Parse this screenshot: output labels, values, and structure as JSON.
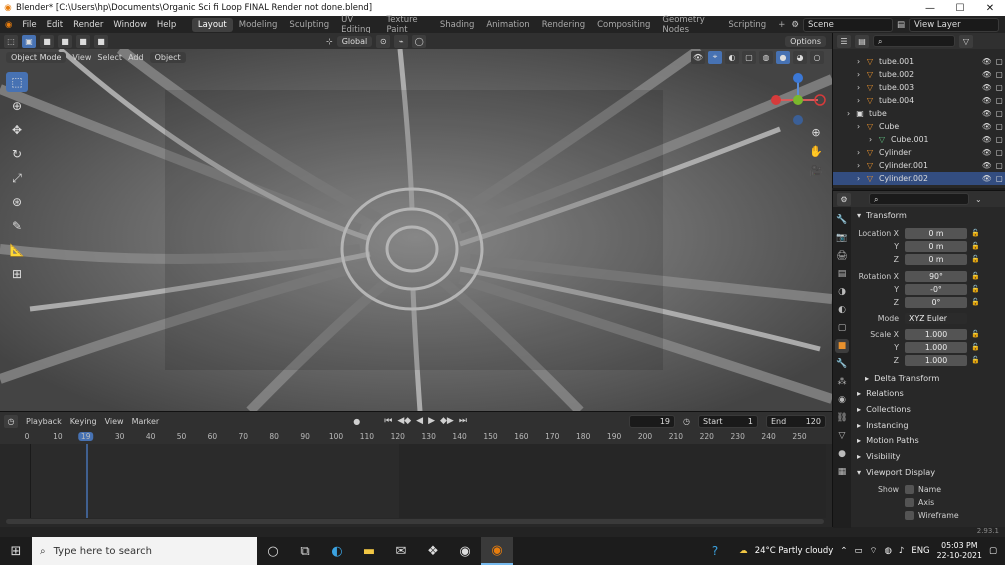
{
  "window": {
    "title": "Blender* [C:\\Users\\hp\\Documents\\Organic Sci fi Loop FINAL Render not done.blend]",
    "minimize": "—",
    "maximize": "☐",
    "close": "✕"
  },
  "menus": [
    "File",
    "Edit",
    "Render",
    "Window",
    "Help"
  ],
  "workspaces": [
    "Layout",
    "Modeling",
    "Sculpting",
    "UV Editing",
    "Texture Paint",
    "Shading",
    "Animation",
    "Rendering",
    "Compositing",
    "Geometry Nodes",
    "Scripting"
  ],
  "active_workspace": "Layout",
  "scene": "Scene",
  "view_layer": "View Layer",
  "viewport": {
    "transform_orientation": "Global",
    "options": "Options",
    "mode": "Object Mode",
    "menus": [
      "View",
      "Select",
      "Add",
      "Object"
    ]
  },
  "outliner": {
    "rows": [
      {
        "label": "tube.001",
        "icon": "object-icon",
        "sel": false
      },
      {
        "label": "tube.002",
        "icon": "object-icon",
        "sel": false
      },
      {
        "label": "tube.003",
        "icon": "object-icon",
        "sel": false
      },
      {
        "label": "tube.004",
        "icon": "object-icon",
        "sel": false
      },
      {
        "label": "tube",
        "icon": "collection-icon",
        "sel": false
      },
      {
        "label": "Cube",
        "icon": "object-icon",
        "sel": false
      },
      {
        "label": "Cube.001",
        "icon": "mesh-icon",
        "sel": false
      },
      {
        "label": "Cylinder",
        "icon": "object-icon",
        "sel": false
      },
      {
        "label": "Cylinder.001",
        "icon": "object-icon",
        "sel": false
      },
      {
        "label": "Cylinder.002",
        "icon": "object-icon",
        "sel": true
      }
    ]
  },
  "properties": {
    "transform_title": "Transform",
    "location_label": "Location X",
    "y_label": "Y",
    "z_label": "Z",
    "location": [
      "0 m",
      "0 m",
      "0 m"
    ],
    "rotation_label": "Rotation X",
    "rotation": [
      "90°",
      "-0°",
      "0°"
    ],
    "mode_label": "Mode",
    "mode_value": "XYZ Euler",
    "scale_label": "Scale X",
    "scale": [
      "1.000",
      "1.000",
      "1.000"
    ],
    "sections": [
      "Delta Transform",
      "Relations",
      "Collections",
      "Instancing",
      "Motion Paths",
      "Visibility",
      "Viewport Display"
    ],
    "show_label": "Show",
    "show_items": [
      "Name",
      "Axis",
      "Wireframe"
    ]
  },
  "timeline": {
    "menus": [
      "Playback",
      "Keying",
      "View",
      "Marker"
    ],
    "current_frame": "19",
    "start_label": "Start",
    "start": "1",
    "end_label": "End",
    "end": "120",
    "ticks": [
      "0",
      "10",
      "20",
      "30",
      "40",
      "50",
      "60",
      "70",
      "80",
      "90",
      "100",
      "110",
      "120",
      "130",
      "140",
      "150",
      "160",
      "170",
      "180",
      "190",
      "200",
      "210",
      "220",
      "230",
      "240",
      "250"
    ]
  },
  "version": "2.93.1",
  "taskbar": {
    "search_placeholder": "Type here to search",
    "weather": "24°C  Partly cloudy",
    "lang": "ENG",
    "time": "05:03 PM",
    "date": "22-10-2021"
  }
}
